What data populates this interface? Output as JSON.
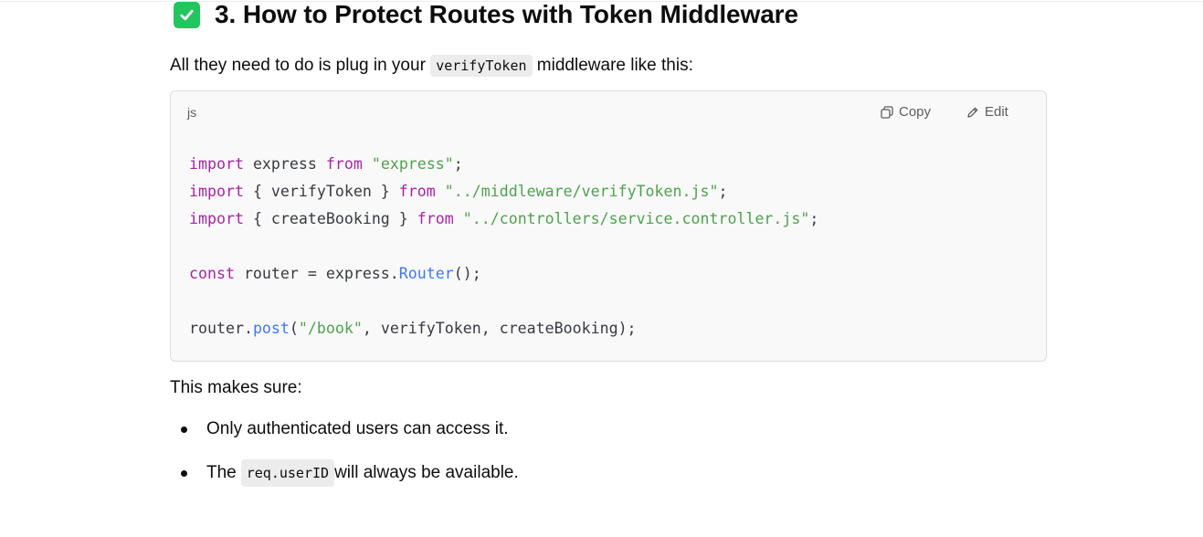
{
  "heading": {
    "icon": "check-box-icon",
    "icon_color": "#22c55e",
    "text": "3. How to Protect Routes with Token Middleware"
  },
  "intro": {
    "before": "All they need to do is plug in your ",
    "code": "verifyToken",
    "after": " middleware like this:"
  },
  "code_block": {
    "language": "js",
    "copy_label": "Copy",
    "edit_label": "Edit",
    "lines": [
      [
        {
          "t": "import",
          "c": "kw"
        },
        {
          "t": " express ",
          "c": ""
        },
        {
          "t": "from",
          "c": "kw"
        },
        {
          "t": " ",
          "c": ""
        },
        {
          "t": "\"express\"",
          "c": "str"
        },
        {
          "t": ";",
          "c": ""
        }
      ],
      [
        {
          "t": "import",
          "c": "kw"
        },
        {
          "t": " { verifyToken } ",
          "c": ""
        },
        {
          "t": "from",
          "c": "kw"
        },
        {
          "t": " ",
          "c": ""
        },
        {
          "t": "\"../middleware/verifyToken.js\"",
          "c": "str"
        },
        {
          "t": ";",
          "c": ""
        }
      ],
      [
        {
          "t": "import",
          "c": "kw"
        },
        {
          "t": " { createBooking } ",
          "c": ""
        },
        {
          "t": "from",
          "c": "kw"
        },
        {
          "t": " ",
          "c": ""
        },
        {
          "t": "\"../controllers/service.controller.js\"",
          "c": "str"
        },
        {
          "t": ";",
          "c": ""
        }
      ],
      [],
      [
        {
          "t": "const",
          "c": "kw"
        },
        {
          "t": " router = express.",
          "c": ""
        },
        {
          "t": "Router",
          "c": "fn"
        },
        {
          "t": "();",
          "c": ""
        }
      ],
      [],
      [
        {
          "t": "router.",
          "c": ""
        },
        {
          "t": "post",
          "c": "fn"
        },
        {
          "t": "(",
          "c": ""
        },
        {
          "t": "\"/book\"",
          "c": "str"
        },
        {
          "t": ", verifyToken, createBooking);",
          "c": ""
        }
      ]
    ]
  },
  "summary": "This makes sure:",
  "bullets": [
    {
      "before": "Only authenticated users can access it.",
      "code": "",
      "after": ""
    },
    {
      "before": "The ",
      "code": "req.userID",
      "after": " will always be available."
    }
  ]
}
